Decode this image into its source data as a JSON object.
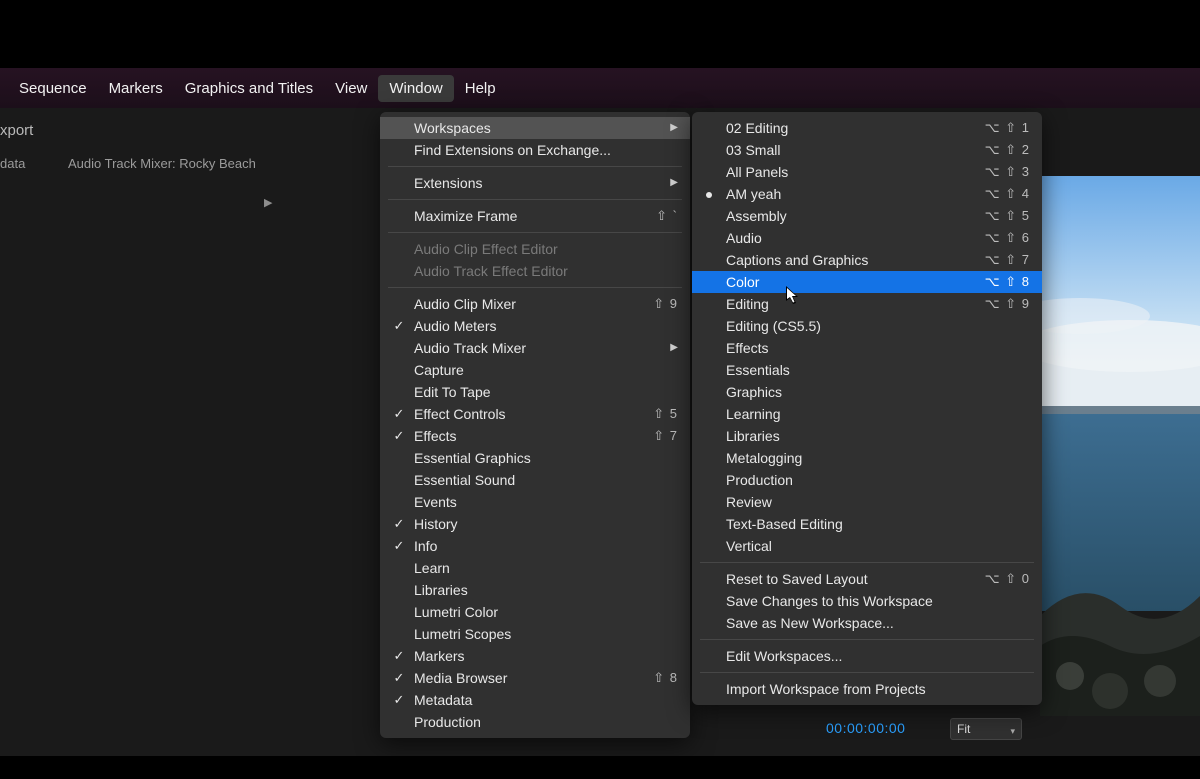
{
  "menubar": {
    "items": [
      "Sequence",
      "Markers",
      "Graphics and Titles",
      "View",
      "Window",
      "Help"
    ],
    "open_index": 4
  },
  "subbar": {
    "row1": "xport",
    "row2_left": "data",
    "row2_right": "Audio Track Mixer: Rocky Beach"
  },
  "transport": {
    "timecode": "00:00:00:00",
    "fit_label": "Fit"
  },
  "window_menu": {
    "items": [
      {
        "type": "item",
        "label": "Workspaces",
        "submenu": true,
        "highlight": true
      },
      {
        "type": "item",
        "label": "Find Extensions on Exchange..."
      },
      {
        "type": "sep"
      },
      {
        "type": "item",
        "label": "Extensions",
        "submenu": true
      },
      {
        "type": "sep"
      },
      {
        "type": "item",
        "label": "Maximize Frame",
        "shortcut": "⇧ `"
      },
      {
        "type": "sep"
      },
      {
        "type": "item",
        "label": "Audio Clip Effect Editor",
        "disabled": true
      },
      {
        "type": "item",
        "label": "Audio Track Effect Editor",
        "disabled": true
      },
      {
        "type": "sep"
      },
      {
        "type": "item",
        "label": "Audio Clip Mixer",
        "shortcut": "⇧ 9"
      },
      {
        "type": "item",
        "label": "Audio Meters",
        "checked": true
      },
      {
        "type": "item",
        "label": "Audio Track Mixer",
        "submenu": true
      },
      {
        "type": "item",
        "label": "Capture"
      },
      {
        "type": "item",
        "label": "Edit To Tape"
      },
      {
        "type": "item",
        "label": "Effect Controls",
        "checked": true,
        "shortcut": "⇧ 5"
      },
      {
        "type": "item",
        "label": "Effects",
        "checked": true,
        "shortcut": "⇧ 7"
      },
      {
        "type": "item",
        "label": "Essential Graphics"
      },
      {
        "type": "item",
        "label": "Essential Sound"
      },
      {
        "type": "item",
        "label": "Events"
      },
      {
        "type": "item",
        "label": "History",
        "checked": true
      },
      {
        "type": "item",
        "label": "Info",
        "checked": true
      },
      {
        "type": "item",
        "label": "Learn"
      },
      {
        "type": "item",
        "label": "Libraries"
      },
      {
        "type": "item",
        "label": "Lumetri Color"
      },
      {
        "type": "item",
        "label": "Lumetri Scopes"
      },
      {
        "type": "item",
        "label": "Markers",
        "checked": true
      },
      {
        "type": "item",
        "label": "Media Browser",
        "checked": true,
        "shortcut": "⇧ 8"
      },
      {
        "type": "item",
        "label": "Metadata",
        "checked": true
      },
      {
        "type": "item",
        "label": "Production"
      }
    ]
  },
  "workspaces_menu": {
    "items": [
      {
        "type": "item",
        "label": "02 Editing",
        "shortcut": "⌥ ⇧ 1"
      },
      {
        "type": "item",
        "label": "03 Small",
        "shortcut": "⌥ ⇧ 2"
      },
      {
        "type": "item",
        "label": "All Panels",
        "shortcut": "⌥ ⇧ 3"
      },
      {
        "type": "item",
        "label": "AM yeah",
        "shortcut": "⌥ ⇧ 4",
        "dot": true
      },
      {
        "type": "item",
        "label": "Assembly",
        "shortcut": "⌥ ⇧ 5"
      },
      {
        "type": "item",
        "label": "Audio",
        "shortcut": "⌥ ⇧ 6"
      },
      {
        "type": "item",
        "label": "Captions and Graphics",
        "shortcut": "⌥ ⇧ 7"
      },
      {
        "type": "item",
        "label": "Color",
        "shortcut": "⌥ ⇧ 8",
        "selected": true
      },
      {
        "type": "item",
        "label": "Editing",
        "shortcut": "⌥ ⇧ 9"
      },
      {
        "type": "item",
        "label": "Editing (CS5.5)"
      },
      {
        "type": "item",
        "label": "Effects"
      },
      {
        "type": "item",
        "label": "Essentials"
      },
      {
        "type": "item",
        "label": "Graphics"
      },
      {
        "type": "item",
        "label": "Learning"
      },
      {
        "type": "item",
        "label": "Libraries"
      },
      {
        "type": "item",
        "label": "Metalogging"
      },
      {
        "type": "item",
        "label": "Production"
      },
      {
        "type": "item",
        "label": "Review"
      },
      {
        "type": "item",
        "label": "Text-Based Editing"
      },
      {
        "type": "item",
        "label": "Vertical"
      },
      {
        "type": "sep"
      },
      {
        "type": "item",
        "label": "Reset to Saved Layout",
        "shortcut": "⌥ ⇧ 0"
      },
      {
        "type": "item",
        "label": "Save Changes to this Workspace"
      },
      {
        "type": "item",
        "label": "Save as New Workspace..."
      },
      {
        "type": "sep"
      },
      {
        "type": "item",
        "label": "Edit Workspaces..."
      },
      {
        "type": "sep"
      },
      {
        "type": "item",
        "label": "Import Workspace from Projects"
      }
    ]
  }
}
